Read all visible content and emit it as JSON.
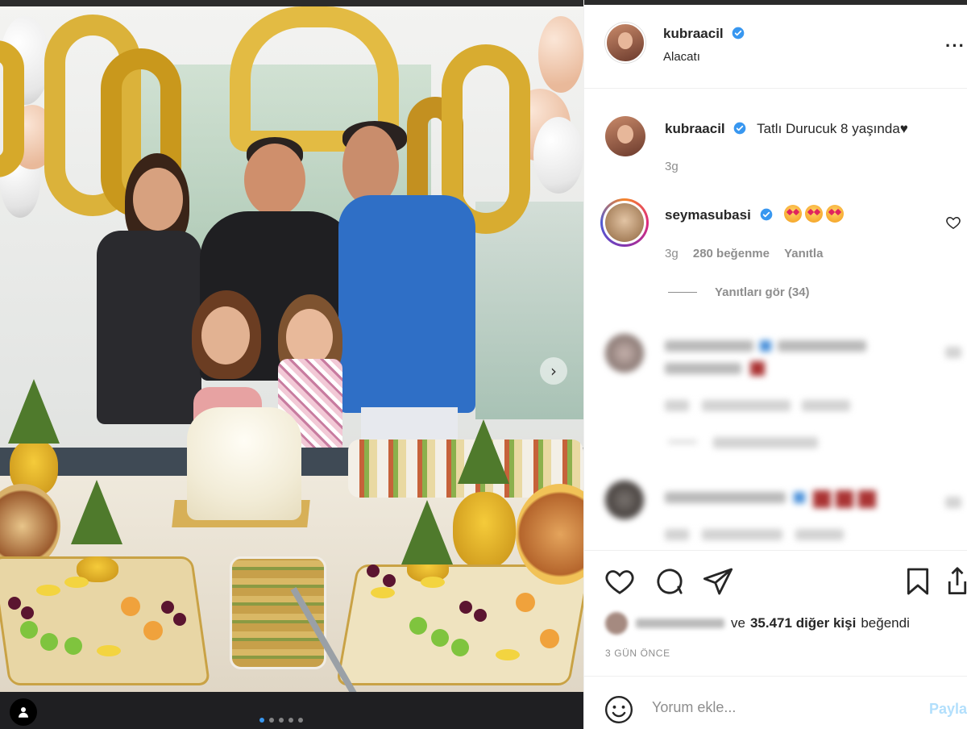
{
  "post": {
    "username": "kubraacil",
    "location": "Alacatı",
    "more_label": "···"
  },
  "caption": {
    "username": "kubraacil",
    "text": "Tatlı Durucuk 8 yaşında♥",
    "time": "3g"
  },
  "top_comment": {
    "username": "seymasubasi",
    "emoji_count": 3,
    "time": "3g",
    "likes": "280 beğenme",
    "reply": "Yanıtla",
    "view_replies": "Yanıtları gör (34)"
  },
  "likes": {
    "text_prefix": "ve",
    "count": "35.471 diğer kişi",
    "suffix": "beğendi"
  },
  "date": "3 GÜN ÖNCE",
  "comment_box": {
    "placeholder": "Yorum ekle...",
    "post_label": "Paylaş"
  },
  "carousel": {
    "total": 5,
    "active": 0
  },
  "icons": {
    "header_verified": "verified-badge-icon",
    "like": "heart-icon",
    "comment": "comment-icon",
    "share": "send-icon",
    "save": "bookmark-icon",
    "emoji": "smiley-icon",
    "tag": "user-tag-icon",
    "next": "chevron-right-icon"
  },
  "colors": {
    "verified": "#3897f0",
    "text": "#262626",
    "muted": "#8e8e8e",
    "post_disabled": "#b2dffc"
  }
}
